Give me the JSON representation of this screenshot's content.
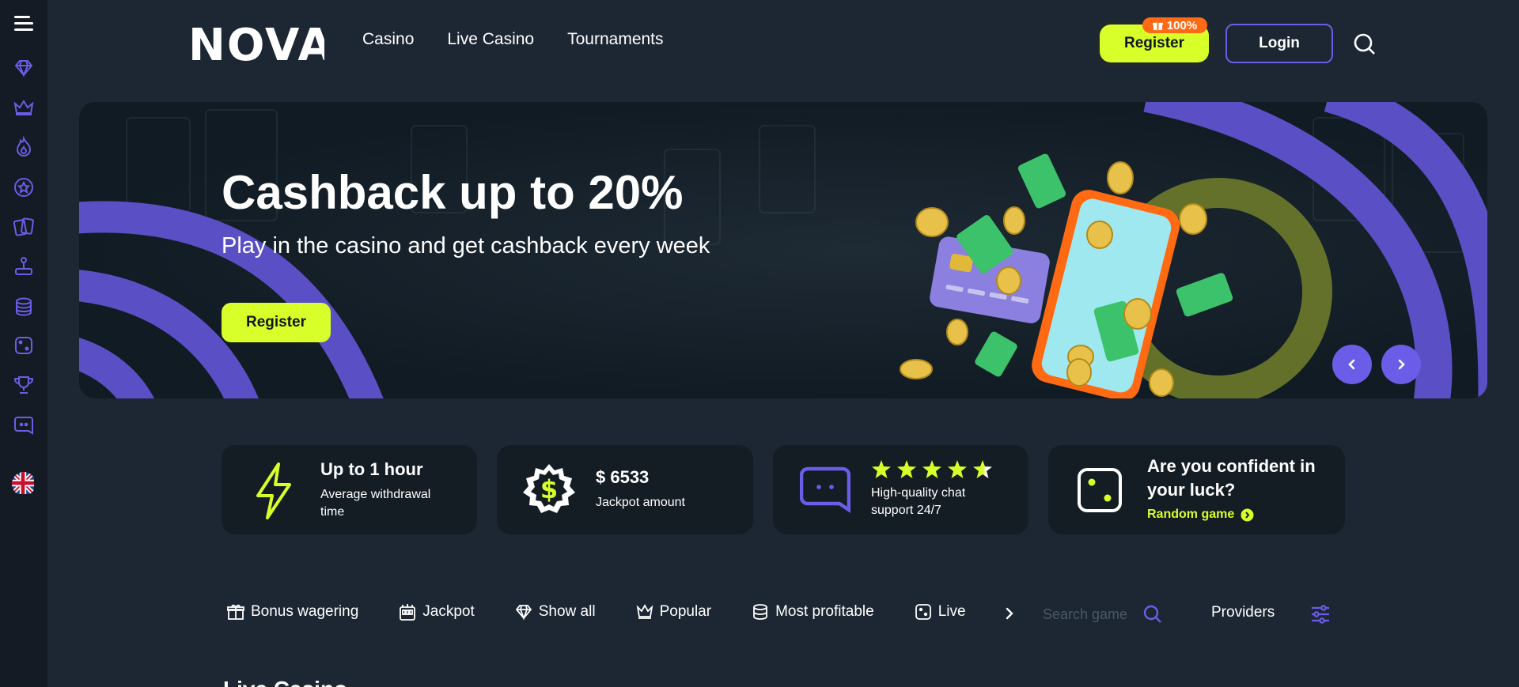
{
  "brand": {
    "logo_text": "NOVA",
    "accent": "#d8ff2a",
    "purple": "#6b5de7",
    "orange": "#ff6a13"
  },
  "nav": {
    "items": [
      "Casino",
      "Live Casino",
      "Tournaments"
    ]
  },
  "header": {
    "register_label": "Register",
    "badge_text": "100%",
    "login_label": "Login",
    "search_icon": "search-icon"
  },
  "sidebar": {
    "items": [
      "menu-icon",
      "diamond-icon",
      "crown-icon",
      "flame-icon",
      "star-badge-icon",
      "cards-icon",
      "joystick-icon",
      "coins-icon",
      "dice-icon",
      "trophy-icon",
      "chat-icon",
      "uk-flag-icon"
    ]
  },
  "banner": {
    "title": "Cashback up to 20%",
    "subtitle": "Play in the casino and get cashback every week",
    "button_label": "Register"
  },
  "features": {
    "withdrawal": {
      "title": "Up to 1 hour",
      "desc": "Average withdrawal time",
      "icon": "lightning-icon"
    },
    "jackpot": {
      "title": "$ 6533",
      "desc": "Jackpot amount",
      "icon": "dollar-badge-icon"
    },
    "support": {
      "rating": 5,
      "desc": "High-quality chat support 24/7",
      "icon": "chat-icon"
    },
    "luck": {
      "title": "Are you confident in your luck?",
      "link": "Random game",
      "icon": "dice-icon"
    }
  },
  "categories": {
    "items": [
      {
        "label": "Bonus wagering",
        "icon": "gift-icon"
      },
      {
        "label": "Jackpot",
        "icon": "slot-machine-icon"
      },
      {
        "label": "Show all",
        "icon": "diamond-icon"
      },
      {
        "label": "Popular",
        "icon": "crown-icon"
      },
      {
        "label": "Most profitable",
        "icon": "coins-icon"
      },
      {
        "label": "Live",
        "icon": "dice-icon"
      }
    ],
    "search_placeholder": "Search game",
    "providers_label": "Providers"
  },
  "section_peek": "Live Casino"
}
